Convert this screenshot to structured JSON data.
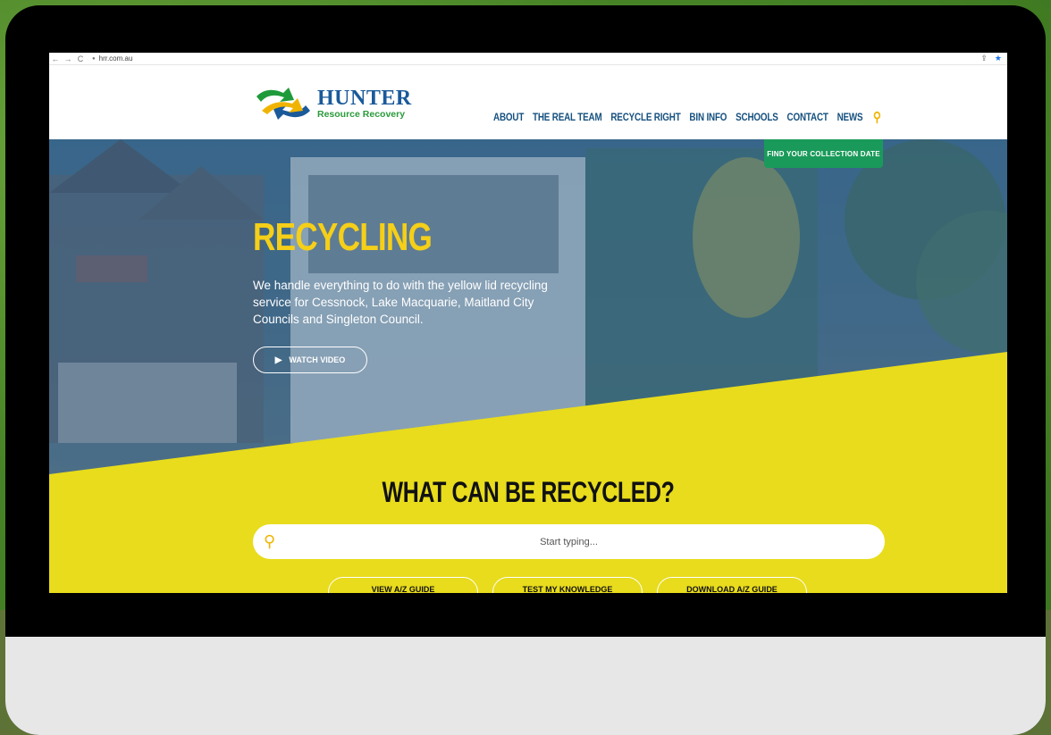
{
  "browser": {
    "url": "hrr.com.au",
    "back": "←",
    "forward": "→",
    "reload": "C",
    "share": "⇪",
    "bookmark": "★"
  },
  "logo": {
    "name": "HUNTER",
    "subtitle": "Resource Recovery"
  },
  "nav": {
    "items": [
      "ABOUT",
      "THE REAL TEAM",
      "RECYCLE RIGHT",
      "BIN INFO",
      "SCHOOLS",
      "CONTACT",
      "NEWS"
    ]
  },
  "hero": {
    "collection_button": "FIND YOUR COLLECTION DATE",
    "title": "RECYCLING",
    "description": "We handle everything to do with the yellow lid recycling service for Cessnock, Lake Macquarie, Maitland City Councils and Singleton Council.",
    "watch_button": "WATCH VIDEO"
  },
  "recycle_section": {
    "heading": "WHAT CAN BE RECYCLED?",
    "search_placeholder": "Start typing...",
    "buttons": [
      "VIEW A/Z GUIDE",
      "TEST MY KNOWLEDGE",
      "DOWNLOAD A/Z GUIDE"
    ]
  },
  "colors": {
    "brand_blue": "#15507f",
    "brand_yellow": "#f5cf18",
    "section_yellow": "#e8dc1c",
    "cta_green": "#1a9a5a"
  },
  "icons": [
    "search-icon",
    "play-icon",
    "lock-icon",
    "star-icon"
  ]
}
